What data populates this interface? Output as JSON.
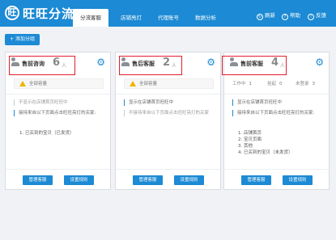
{
  "header": {
    "logo_glyph": "旺",
    "app_title": "旺旺分流",
    "tabs": [
      {
        "label": "分流客服",
        "active": true
      },
      {
        "label": "店铺亮灯",
        "active": false
      },
      {
        "label": "代理账号",
        "active": false
      },
      {
        "label": "数据分析",
        "active": false
      }
    ],
    "actions": {
      "refresh": "刷新",
      "help": "帮助",
      "feedback": "反馈"
    }
  },
  "toolbar": {
    "add_group": "+ 添加分组"
  },
  "cards": [
    {
      "name": "售前咨询",
      "count": "6",
      "unit": "人",
      "warning": "全部容量",
      "rules": [
        "不显示在店铺首页旺旺中",
        "接待来自以下页面点击旺旺亮灯的买家:"
      ],
      "list": [
        "1. 已买到的宝贝（已发货）"
      ],
      "buttons": {
        "manage": "管理客服",
        "settings": "设置规则"
      }
    },
    {
      "name": "售后客服",
      "count": "2",
      "unit": "人",
      "warning": "全部容量",
      "rules": [
        "显示在店铺首页旺旺中",
        "不接待来自以下页面点击旺旺亮灯的买家"
      ],
      "list": [],
      "buttons": {
        "manage": "管理客服",
        "settings": "设置规则"
      }
    },
    {
      "name": "售前客服",
      "count": "4",
      "unit": "人",
      "stats": [
        {
          "label": "工作中",
          "value": "1"
        },
        {
          "label": "挂起",
          "value": "0"
        },
        {
          "label": "未登录",
          "value": "3"
        }
      ],
      "rules": [
        "显示在店铺首页旺旺中",
        "接待来自以下页面点击旺旺亮灯的买家:"
      ],
      "list": [
        "1. 店铺首页",
        "2. 宝贝页面",
        "3. 其他",
        "4. 已买到的宝贝（未发货）"
      ],
      "buttons": {
        "manage": "管理客服",
        "settings": "设置规则"
      }
    }
  ]
}
